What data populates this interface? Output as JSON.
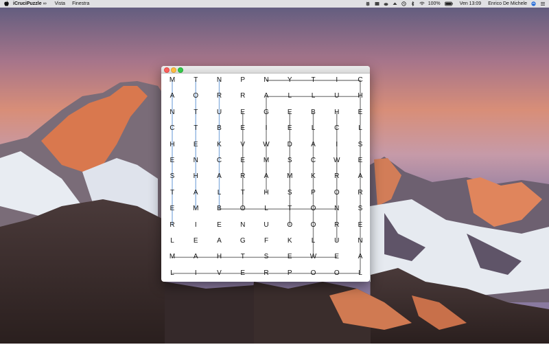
{
  "menubar": {
    "app_name": "iCruciPuzzle",
    "menus": [
      "Vista",
      "Finestra"
    ],
    "battery": "100%",
    "clock": "Ven 13:09",
    "user": "Enrico De Michele"
  },
  "window": {
    "title": "",
    "grid": [
      [
        "M",
        "T",
        "N",
        "P",
        "N",
        "Y",
        "T",
        "I",
        "C"
      ],
      [
        "A",
        "O",
        "R",
        "R",
        "A",
        "L",
        "L",
        "U",
        "H"
      ],
      [
        "N",
        "T",
        "U",
        "E",
        "G",
        "E",
        "B",
        "H",
        "E"
      ],
      [
        "C",
        "T",
        "B",
        "E",
        "I",
        "E",
        "L",
        "C",
        "L"
      ],
      [
        "H",
        "E",
        "K",
        "V",
        "W",
        "D",
        "A",
        "I",
        "S"
      ],
      [
        "E",
        "N",
        "C",
        "E",
        "M",
        "S",
        "C",
        "W",
        "E"
      ],
      [
        "S",
        "H",
        "A",
        "R",
        "A",
        "M",
        "K",
        "R",
        "A"
      ],
      [
        "T",
        "A",
        "L",
        "T",
        "H",
        "S",
        "P",
        "O",
        "R"
      ],
      [
        "E",
        "M",
        "B",
        "O",
        "L",
        "T",
        "O",
        "N",
        "S"
      ],
      [
        "R",
        "I",
        "E",
        "N",
        "U",
        "O",
        "O",
        "R",
        "E"
      ],
      [
        "L",
        "E",
        "A",
        "G",
        "F",
        "K",
        "L",
        "U",
        "N"
      ],
      [
        "M",
        "A",
        "H",
        "T",
        "S",
        "E",
        "W",
        "E",
        "A"
      ],
      [
        "L",
        "I",
        "V",
        "E",
        "R",
        "P",
        "O",
        "O",
        "L"
      ]
    ],
    "found_words": [
      {
        "name": "word-manchester",
        "color": "#8fb4e0",
        "from": [
          0,
          0
        ],
        "to": [
          9,
          0
        ]
      },
      {
        "name": "word-tottenham",
        "color": "#8fb4e0",
        "from": [
          0,
          1
        ],
        "to": [
          8,
          1
        ]
      },
      {
        "name": "word-newcastle",
        "color": "#8fb4e0",
        "from": [
          0,
          2
        ],
        "to": [
          8,
          2
        ]
      },
      {
        "name": "word-liverpool",
        "color": "#888888",
        "from": [
          12,
          0
        ],
        "to": [
          12,
          8
        ]
      },
      {
        "name": "word-westham",
        "color": "#888888",
        "from": [
          11,
          7
        ],
        "to": [
          11,
          0
        ]
      },
      {
        "name": "word-bolton",
        "color": "#888888",
        "from": [
          8,
          2
        ],
        "to": [
          8,
          7
        ]
      },
      {
        "name": "word-chelsea",
        "color": "#888888",
        "from": [
          0,
          8
        ],
        "to": [
          6,
          8
        ]
      },
      {
        "name": "word-arsenal",
        "color": "#888888",
        "from": [
          6,
          8
        ],
        "to": [
          12,
          8
        ]
      },
      {
        "name": "word-fulham",
        "color": "#888888",
        "from": [
          1,
          8
        ],
        "to": [
          1,
          4
        ]
      },
      {
        "name": "word-pny",
        "color": "#888888",
        "from": [
          0,
          4
        ],
        "to": [
          0,
          8
        ]
      },
      {
        "name": "word-col3",
        "color": "#888888",
        "from": [
          2,
          3
        ],
        "to": [
          8,
          3
        ]
      },
      {
        "name": "word-col4",
        "color": "#888888",
        "from": [
          1,
          4
        ],
        "to": [
          7,
          4
        ]
      },
      {
        "name": "word-col5",
        "color": "#888888",
        "from": [
          2,
          5
        ],
        "to": [
          9,
          5
        ]
      },
      {
        "name": "word-col6",
        "color": "#888888",
        "from": [
          2,
          6
        ],
        "to": [
          11,
          6
        ]
      },
      {
        "name": "word-col7",
        "color": "#888888",
        "from": [
          2,
          7
        ],
        "to": [
          10,
          7
        ]
      }
    ]
  }
}
